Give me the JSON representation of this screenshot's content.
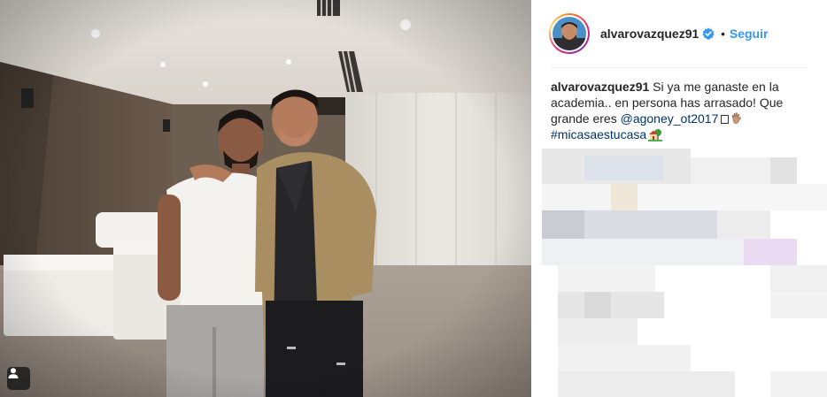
{
  "header": {
    "username": "alvarovazquez91",
    "separator": "•",
    "follow_label": "Seguir"
  },
  "caption": {
    "username": "alvarovazquez91",
    "text_part1": " Si ya me ganaste en la academia.. en persona has arrasado! Que grande eres ",
    "mention": "@agoney_ot2017",
    "hashtag": "#micasaestucasa"
  },
  "icons": {
    "verified": "verified-badge-icon",
    "tag": "user-tag-icon",
    "emoji_1": "square-glyph-emoji",
    "emoji_2": "waving-hand-emoji",
    "emoji_3": "house-with-garden-emoji"
  },
  "colors": {
    "link_blue": "#3897f0",
    "mention_blue": "#003569",
    "text": "#262626",
    "verified_blue": "#3897f0"
  }
}
